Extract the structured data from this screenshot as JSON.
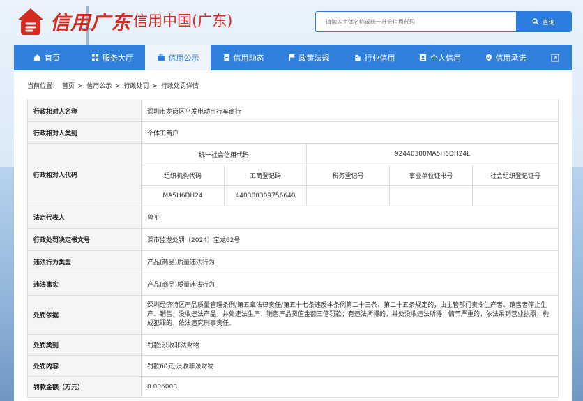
{
  "header": {
    "logo_text": "信用广东",
    "site_title": "信用中国(广东)",
    "search_placeholder": "请输入主体名称或统一社会信用代码",
    "search_button": "查询"
  },
  "nav": {
    "items": [
      {
        "label": "首页",
        "icon": "home-icon"
      },
      {
        "label": "服务大厅",
        "icon": "grid-icon"
      },
      {
        "label": "信用公示",
        "icon": "briefcase-icon",
        "active": true
      },
      {
        "label": "信用动态",
        "icon": "document-icon"
      },
      {
        "label": "政策法规",
        "icon": "flag-icon"
      },
      {
        "label": "行业信用",
        "icon": "building-icon"
      },
      {
        "label": "个人信用",
        "icon": "person-card-icon"
      },
      {
        "label": "信用承诺",
        "icon": "shield-check-icon"
      }
    ],
    "extra_icon": "expand-icon"
  },
  "breadcrumb": {
    "prefix": "当前位置：",
    "items": [
      "首页",
      "信用公示",
      "行政处罚",
      "行政处罚详情"
    ],
    "separator": ">"
  },
  "record": {
    "name_label": "行政相对人名称",
    "name_value": "深圳市龙岗区平发电动自行车商行",
    "type_label": "行政相对人类别",
    "type_value": "个体工商户",
    "code_label": "行政相对人代码",
    "uscc_label": "统一社会信用代码",
    "uscc_value": "92440300MA5H6DH24L",
    "org_code_label": "组织机构代码",
    "biz_reg_label": "工商登记码",
    "tax_label": "税务登记号",
    "inst_label": "事业单位证书号",
    "social_label": "社会组织登记证号",
    "org_code_value": "MA5H6DH24",
    "biz_reg_value": "440300309756640",
    "tax_value": "",
    "inst_value": "",
    "social_value": "",
    "rep_label": "法定代表人",
    "rep_value": "曾平",
    "doc_label": "行政处罚决定书文号",
    "doc_value": "深市监龙处罚〔2024〕宝龙62号",
    "viol_type_label": "违法行为类型",
    "viol_type_value": "产品(商品)质量违法行为",
    "viol_fact_label": "违法事实",
    "viol_fact_value": "产品(商品)质量违法行为",
    "basis_label": "处罚依据",
    "basis_value": "深圳经济特区产品质量管理条例/第五章法律责任/第五十七条违反本条例第二十三条、第二十五条规定的，由主管部门责令生产者、销售者停止生产、销售，没收违法产品，并处违法生产、销售产品货值金额三倍罚款；有违法所得的，并处没收违法所得；情节严重的，依法吊销营业执照；构成犯罪的，依法追究刑事责任。",
    "pen_type_label": "处罚类别",
    "pen_type_value": "罚款;没收非法财物",
    "pen_content_label": "处罚内容",
    "pen_content_value": "罚款60元;没收非法财物",
    "fine_label": "罚款金额（万元）",
    "fine_value": "0.006000"
  },
  "colors": {
    "nav": "#2f7fdb",
    "brand_red": "#d42a20",
    "search_button": "#2d7de0"
  }
}
